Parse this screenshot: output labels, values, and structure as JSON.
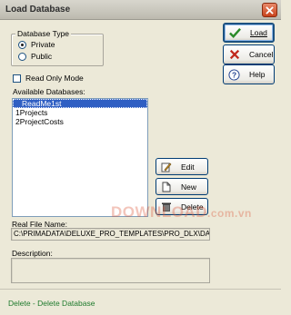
{
  "window": {
    "title": "Load Database"
  },
  "database_type": {
    "legend": "Database Type",
    "options": [
      {
        "label": "Private",
        "selected": true
      },
      {
        "label": "Public",
        "selected": false
      }
    ]
  },
  "read_only": {
    "label": "Read Only Mode",
    "checked": false
  },
  "available": {
    "label": "Available Databases:",
    "items": [
      "ReadMe1st",
      "1Projects",
      "2ProjectCosts"
    ],
    "selected_index": 0
  },
  "buttons": {
    "load": "Load",
    "cancel": "Cancel",
    "help": "Help",
    "edit": "Edit",
    "new": "New",
    "delete": "Delete"
  },
  "real_file": {
    "label": "Real File Name:",
    "value": "C:\\PRIMADATA\\DELUXE_PRO_TEMPLATES\\PRO_DLX\\DAT"
  },
  "description": {
    "label": "Description:",
    "value": ""
  },
  "status": "Delete - Delete Database",
  "watermark": {
    "main": "DOWNLOAD",
    "suffix": ".com.vn"
  }
}
